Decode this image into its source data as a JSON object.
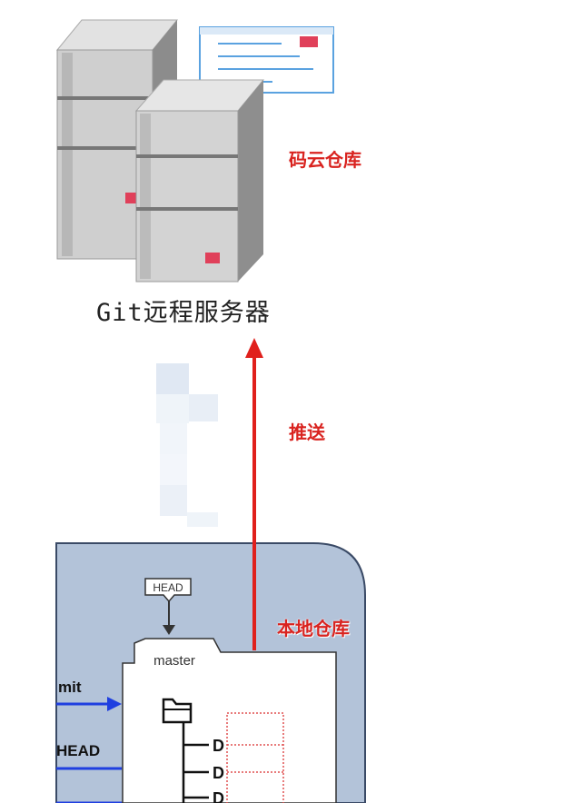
{
  "remote_server": {
    "caption": "Git远程服务器",
    "label": "码云仓库"
  },
  "push_arrow": {
    "label": "推送"
  },
  "local_repo": {
    "label": "本地仓库",
    "head_label": "HEAD",
    "branch_label": "master",
    "left_labels": [
      "mit",
      "HEAD"
    ]
  },
  "colors": {
    "arrow": "#e0201c",
    "label_text": "#d9231f",
    "local_repo_bg": "#b3c3d9",
    "server_gray": "#c9c9c9",
    "pointer_blue": "#1f3fe0"
  }
}
